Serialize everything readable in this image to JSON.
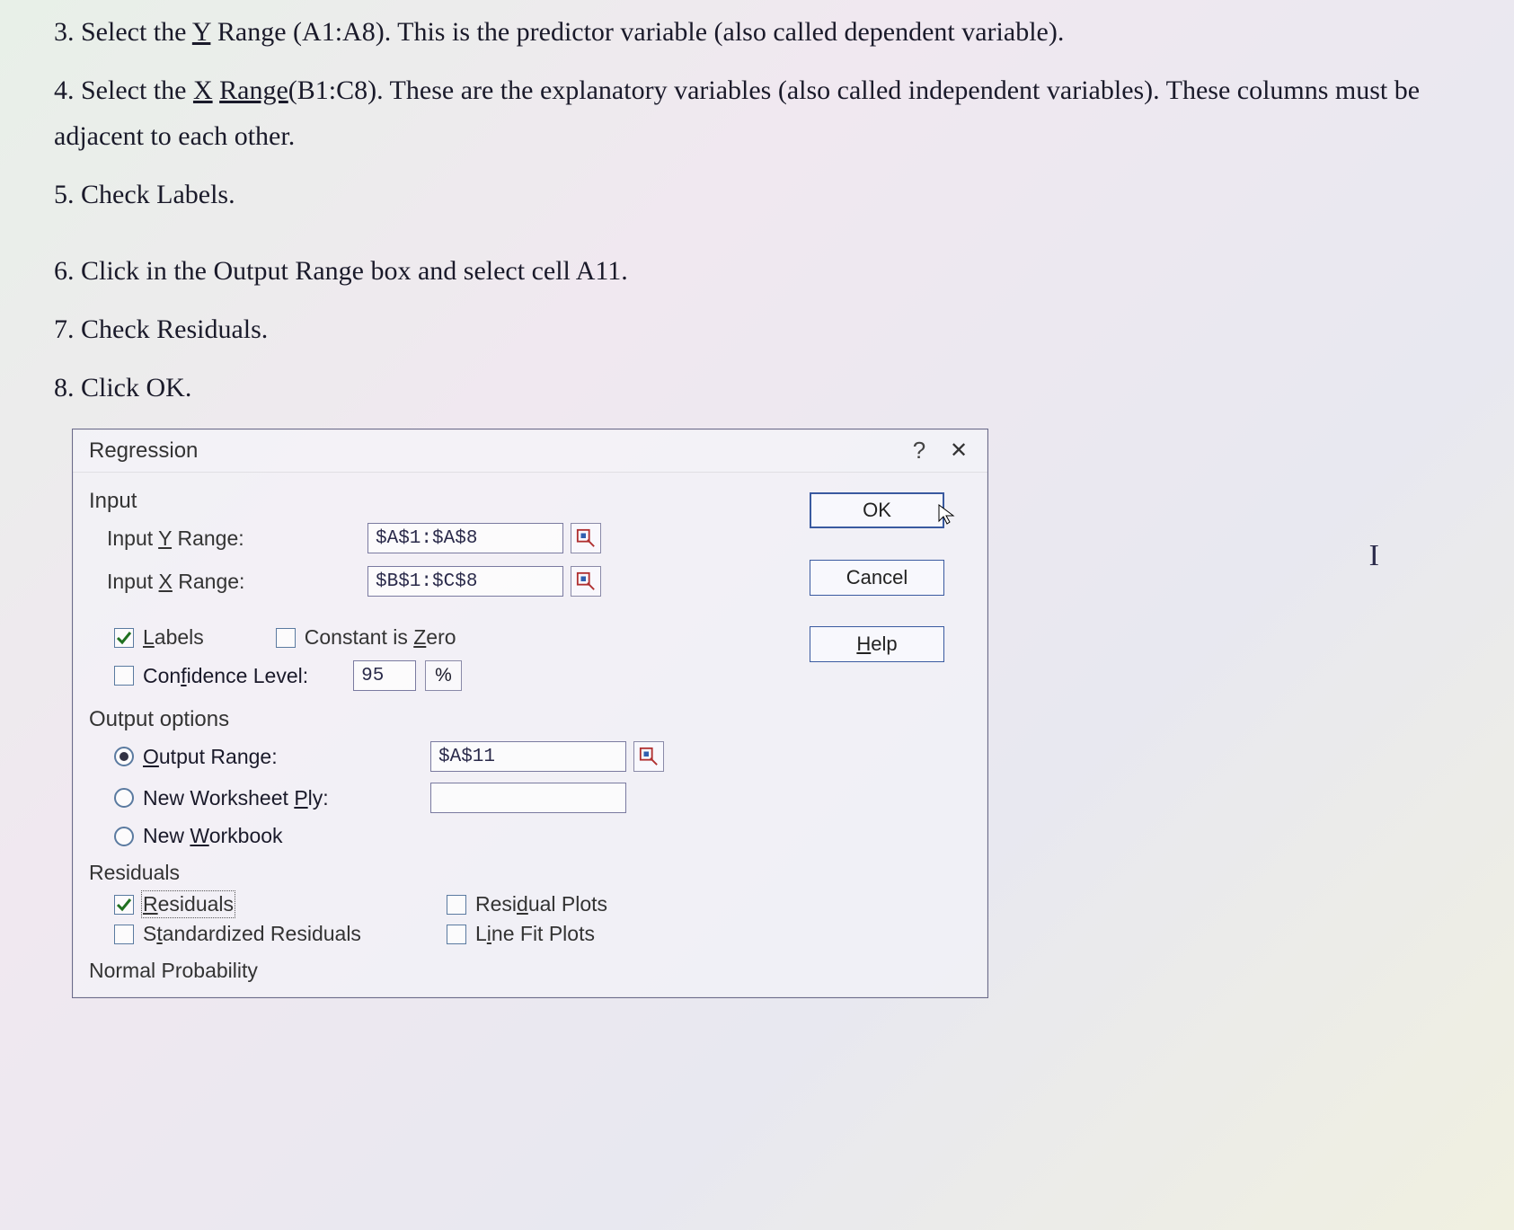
{
  "instructions": {
    "line3_a": "3. Select the ",
    "line3_u": "Y",
    "line3_b": " Range (A1:A8). This is the predictor variable (also called dependent variable).",
    "line4_a": "4. Select the ",
    "line4_u": "X",
    "line4_sp": " ",
    "line4_u2": "Range",
    "line4_b": "(B1:C8). These are the explanatory variables (also called independent variables). These columns must be adjacent to each other.",
    "line5": "5. Check Labels.",
    "line6": "6. Click in the Output Range box and select cell A11.",
    "line7": "7. Check Residuals.",
    "line8": "8. Click OK."
  },
  "dialog": {
    "title": "Regression",
    "help_icon": "?",
    "close_icon": "✕",
    "sections": {
      "input_title": "Input",
      "input_y_label_pre": "Input ",
      "input_y_hot": "Y",
      "input_y_label_post": " Range:",
      "input_y_value": "$A$1:$A$8",
      "input_x_label_pre": "Input ",
      "input_x_hot": "X",
      "input_x_label_post": " Range:",
      "input_x_value": "$B$1:$C$8",
      "labels_hot": "L",
      "labels_text": "abels",
      "const_zero_pre": "Constant is ",
      "const_zero_hot": "Z",
      "const_zero_post": "ero",
      "conf_pre": "Con",
      "conf_hot": "f",
      "conf_post": "idence Level:",
      "conf_value": "95",
      "pct": "%",
      "output_title": "Output options",
      "out_range_hot": "O",
      "out_range_text": "utput Range:",
      "out_range_value": "$A$11",
      "new_ws_pre": "New Worksheet ",
      "new_ws_hot": "P",
      "new_ws_post": "ly:",
      "new_ws_value": "",
      "new_wb_pre": "New ",
      "new_wb_hot": "W",
      "new_wb_post": "orkbook",
      "resid_title": "Residuals",
      "resid_hot": "R",
      "resid_text": "esiduals",
      "std_resid_pre": "S",
      "std_resid_hot": "t",
      "std_resid_post": "andardized Residuals",
      "resid_plots_pre": "Resi",
      "resid_plots_hot": "d",
      "resid_plots_post": "ual Plots",
      "line_fit_pre": "L",
      "line_fit_hot": "i",
      "line_fit_post": "ne Fit Plots",
      "normprob_title": "Normal Probability"
    },
    "buttons": {
      "ok": "OK",
      "cancel": "Cancel",
      "help_hot": "H",
      "help_post": "elp"
    },
    "states": {
      "labels_checked": true,
      "const_zero_checked": false,
      "conf_checked": false,
      "output_range_selected": true,
      "new_ws_selected": false,
      "new_wb_selected": false,
      "residuals_checked": true,
      "std_resid_checked": false,
      "resid_plots_checked": false,
      "line_fit_checked": false
    }
  },
  "cursor_glyph": "I"
}
